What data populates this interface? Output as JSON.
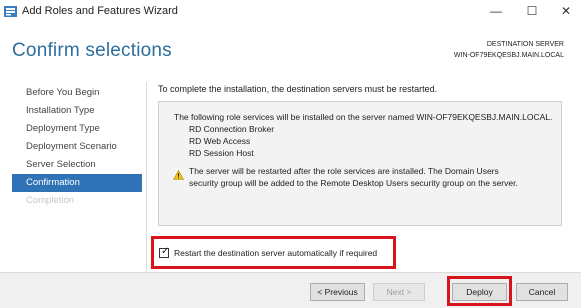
{
  "window": {
    "title": "Add Roles and Features Wizard",
    "minimize_glyph": "—",
    "maximize_glyph": "☐",
    "close_glyph": "✕"
  },
  "header": {
    "title": "Confirm selections",
    "destination_label": "DESTINATION SERVER",
    "destination_value": "WIN-OF79EKQESBJ.MAIN.LOCAL"
  },
  "nav": {
    "items": [
      {
        "label": "Before You Begin"
      },
      {
        "label": "Installation Type"
      },
      {
        "label": "Deployment Type"
      },
      {
        "label": "Deployment Scenario"
      },
      {
        "label": "Server Selection"
      },
      {
        "label": "Confirmation"
      },
      {
        "label": "Completion"
      }
    ]
  },
  "main": {
    "intro": "To complete the installation, the destination servers must be restarted.",
    "box_heading": "The following role services will be installed on the server named WIN-OF79EKQESBJ.MAIN.LOCAL.",
    "services": [
      "RD Connection Broker",
      "RD Web Access",
      "RD Session Host"
    ],
    "warning": "The server will be restarted after the role services are installed. The Domain Users security group will be added to the Remote Desktop Users security group on the server.",
    "restart_label": "Restart the destination server automatically if required",
    "restart_checked": true
  },
  "footer": {
    "previous": "< Previous",
    "next": "Next >",
    "deploy": "Deploy",
    "cancel": "Cancel"
  },
  "colors": {
    "accent_title": "#2e6e9e",
    "nav_active": "#2f73b6",
    "highlight_red": "#d7131b"
  },
  "icons": {
    "app": "server-manager-icon",
    "warning": "warning-triangle-icon",
    "check": "checkmark-icon"
  }
}
